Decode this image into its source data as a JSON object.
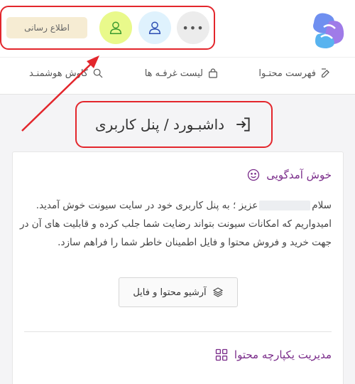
{
  "header": {
    "notify_label": "اطلاع رسانی",
    "more_label": "•••"
  },
  "nav": {
    "items": [
      {
        "label": "فهرست محتـوا",
        "icon": "edit-icon"
      },
      {
        "label": "لیست غرفـه ها",
        "icon": "shopping-bag-icon"
      },
      {
        "label": "کاوش هوشمنـد",
        "icon": "search-icon"
      }
    ]
  },
  "page": {
    "title": "داشبـورد / پنل کاربری"
  },
  "welcome": {
    "title": "خوش آمدگویی",
    "line1_start": "سلام",
    "line1_end": "عزیز ؛ به پنل کاربری خود در سایت سیونت خوش آمدید.",
    "line2": "امیدواریم که امکانات سیونت بتواند رضایت شما جلب کرده و قابلیت های آن در جهت خرید و فروش محتوا و فایل اطمینان خاطر شما را فراهم سازد.",
    "archive_button": "آرشیو محتوا و فایل"
  },
  "integrated": {
    "title": "مدیریت یکپارچه محتوا"
  },
  "colors": {
    "accent_purple": "#7a2c8a",
    "annotation_red": "#e3262c",
    "green_circle": "#e9f98b",
    "blue_circle": "#dff2fd"
  }
}
